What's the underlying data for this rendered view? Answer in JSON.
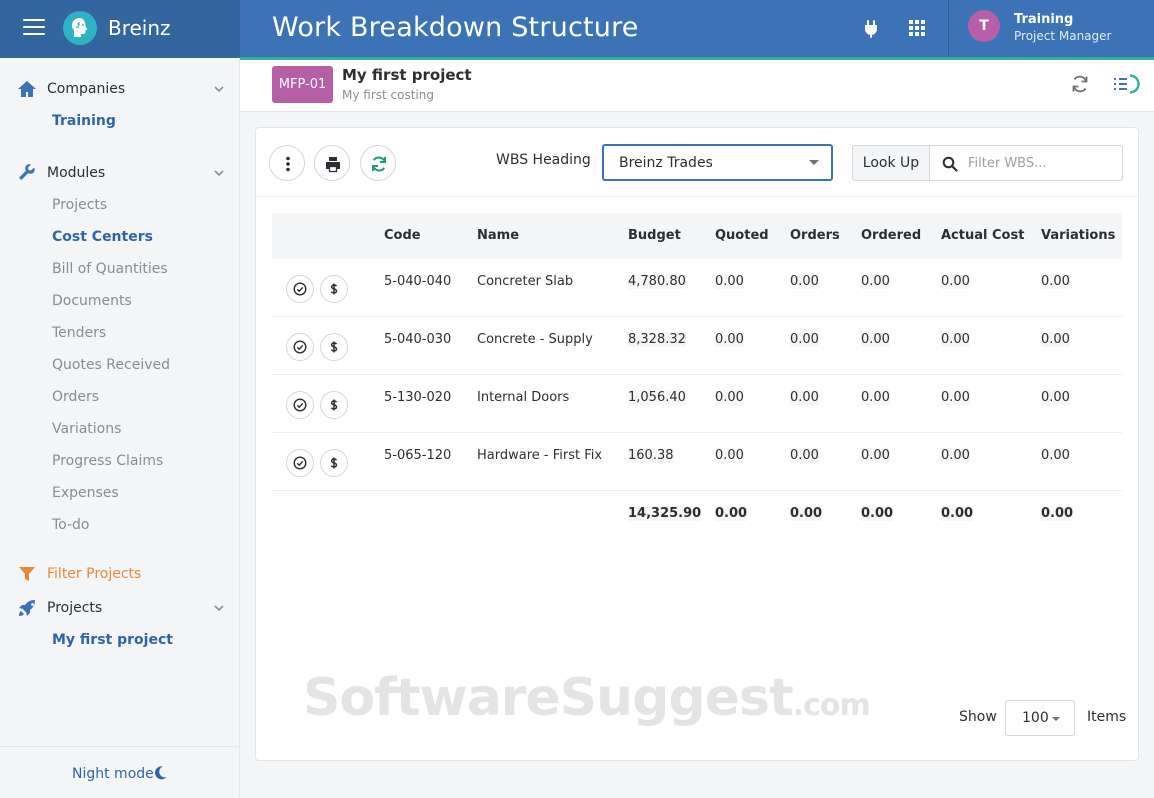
{
  "app": {
    "brand": "Breinz",
    "page_title": "Work Breakdown Structure"
  },
  "user": {
    "initial": "T",
    "name": "Training",
    "role": "Project Manager"
  },
  "sidebar": {
    "companies": {
      "label": "Companies",
      "items": [
        "Training"
      ]
    },
    "modules": {
      "label": "Modules",
      "items": [
        "Projects",
        "Cost Centers",
        "Bill of Quantities",
        "Documents",
        "Tenders",
        "Quotes Received",
        "Orders",
        "Variations",
        "Progress Claims",
        "Expenses",
        "To-do"
      ],
      "active": "Cost Centers"
    },
    "filter_projects": "Filter Projects",
    "projects": {
      "label": "Projects",
      "items": [
        "My first project"
      ]
    },
    "night_mode": "Night mode"
  },
  "project": {
    "code": "MFP-01",
    "name": "My first project",
    "subtitle": "My first costing"
  },
  "toolbar": {
    "wbs_heading_label": "WBS Heading",
    "wbs_heading_value": "Breinz Trades",
    "lookup_label": "Look Up",
    "filter_placeholder": "Filter WBS..."
  },
  "table": {
    "columns": [
      "Code",
      "Name",
      "Budget",
      "Quoted",
      "Orders",
      "Ordered",
      "Actual Cost",
      "Variations"
    ],
    "rows": [
      {
        "code": "5-040-040",
        "name": "Concreter Slab",
        "budget": "4,780.80",
        "quoted": "0.00",
        "orders": "0.00",
        "ordered": "0.00",
        "actual_cost": "0.00",
        "variations": "0.00"
      },
      {
        "code": "5-040-030",
        "name": "Concrete - Supply",
        "budget": "8,328.32",
        "quoted": "0.00",
        "orders": "0.00",
        "ordered": "0.00",
        "actual_cost": "0.00",
        "variations": "0.00"
      },
      {
        "code": "5-130-020",
        "name": "Internal Doors",
        "budget": "1,056.40",
        "quoted": "0.00",
        "orders": "0.00",
        "ordered": "0.00",
        "actual_cost": "0.00",
        "variations": "0.00"
      },
      {
        "code": "5-065-120",
        "name": "Hardware - First Fix",
        "budget": "160.38",
        "quoted": "0.00",
        "orders": "0.00",
        "ordered": "0.00",
        "actual_cost": "0.00",
        "variations": "0.00"
      }
    ],
    "totals": {
      "budget": "14,325.90",
      "quoted": "0.00",
      "orders": "0.00",
      "ordered": "0.00",
      "actual_cost": "0.00",
      "variations": "0.00"
    }
  },
  "pagination": {
    "show_label": "Show",
    "page_size": "100",
    "items_label": "Items"
  },
  "watermark": {
    "main": "SoftwareSuggest",
    "suffix": ".com"
  },
  "colors": {
    "header": "#3b73b6",
    "brand_bg": "#33659f",
    "accent": "#2fb3a0",
    "project_badge": "#b65fa6",
    "link": "#2f65a8",
    "filter": "#e68a3a"
  },
  "icons": {
    "topbar": [
      "hamburger-icon",
      "brain-logo-icon",
      "plug-icon",
      "apps-grid-icon"
    ],
    "project": [
      "refresh-icon",
      "list-progress-icon"
    ],
    "toolbar": [
      "more-vertical-icon",
      "print-icon",
      "sync-icon",
      "search-icon"
    ],
    "row": [
      "check-circle-icon",
      "dollar-icon"
    ]
  }
}
